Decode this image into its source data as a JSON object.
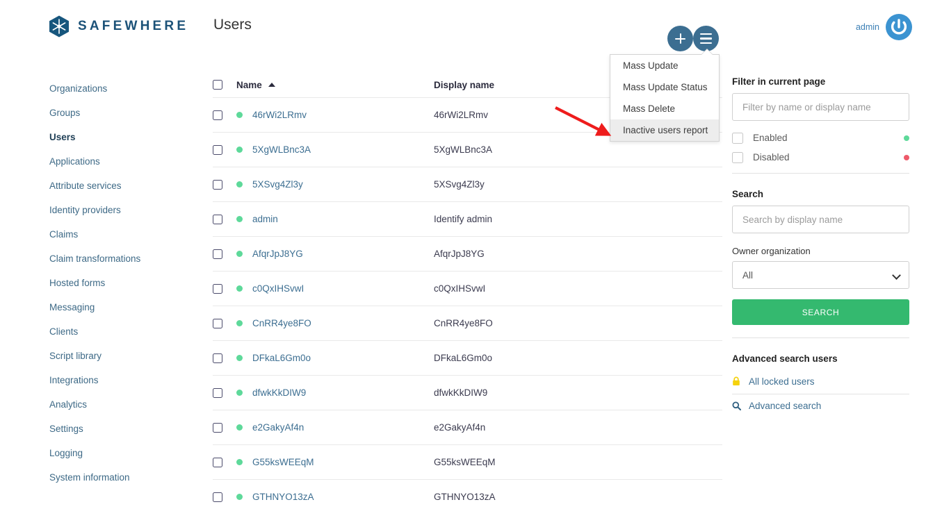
{
  "brand": {
    "name": "SAFEWHERE",
    "logo_icon": "snowflake-hexagon-logo"
  },
  "header": {
    "page_title": "Users",
    "add_button_label": "+",
    "add_icon": "plus-icon",
    "menu_icon": "hamburger-menu-icon",
    "account_name": "admin",
    "avatar_icon": "power-avatar-icon"
  },
  "sidebar": {
    "items": [
      {
        "label": "Organizations",
        "active": false
      },
      {
        "label": "Groups",
        "active": false
      },
      {
        "label": "Users",
        "active": true
      },
      {
        "label": "Applications",
        "active": false
      },
      {
        "label": "Attribute services",
        "active": false
      },
      {
        "label": "Identity providers",
        "active": false
      },
      {
        "label": "Claims",
        "active": false
      },
      {
        "label": "Claim transformations",
        "active": false
      },
      {
        "label": "Hosted forms",
        "active": false
      },
      {
        "label": "Messaging",
        "active": false
      },
      {
        "label": "Clients",
        "active": false
      },
      {
        "label": "Script library",
        "active": false
      },
      {
        "label": "Integrations",
        "active": false
      },
      {
        "label": "Analytics",
        "active": false
      },
      {
        "label": "Settings",
        "active": false
      },
      {
        "label": "Logging",
        "active": false
      },
      {
        "label": "System information",
        "active": false
      }
    ]
  },
  "table": {
    "columns": [
      {
        "label": "Name",
        "sort": "asc",
        "sort_icon": "sort-ascending-caret"
      },
      {
        "label": "Display name",
        "sort": "none"
      }
    ],
    "rows": [
      {
        "status": "enabled",
        "name": "46rWi2LRmv",
        "display_name": "46rWi2LRmv"
      },
      {
        "status": "enabled",
        "name": "5XgWLBnc3A",
        "display_name": "5XgWLBnc3A"
      },
      {
        "status": "enabled",
        "name": "5XSvg4Zl3y",
        "display_name": "5XSvg4Zl3y"
      },
      {
        "status": "enabled",
        "name": "admin",
        "display_name": "Identify admin"
      },
      {
        "status": "enabled",
        "name": "AfqrJpJ8YG",
        "display_name": "AfqrJpJ8YG"
      },
      {
        "status": "enabled",
        "name": "c0QxIHSvwI",
        "display_name": "c0QxIHSvwI"
      },
      {
        "status": "enabled",
        "name": "CnRR4ye8FO",
        "display_name": "CnRR4ye8FO"
      },
      {
        "status": "enabled",
        "name": "DFkaL6Gm0o",
        "display_name": "DFkaL6Gm0o"
      },
      {
        "status": "enabled",
        "name": "dfwkKkDIW9",
        "display_name": "dfwkKkDIW9"
      },
      {
        "status": "enabled",
        "name": "e2GakyAf4n",
        "display_name": "e2GakyAf4n"
      },
      {
        "status": "enabled",
        "name": "G55ksWEEqM",
        "display_name": "G55ksWEEqM"
      },
      {
        "status": "enabled",
        "name": "GTHNYO13zA",
        "display_name": "GTHNYO13zA"
      }
    ]
  },
  "actions_menu": {
    "open": true,
    "items": [
      {
        "label": "Mass Update",
        "highlighted": false
      },
      {
        "label": "Mass Update Status",
        "highlighted": false
      },
      {
        "label": "Mass Delete",
        "highlighted": false
      },
      {
        "label": "Inactive users report",
        "highlighted": true
      }
    ]
  },
  "annotation": {
    "type": "red-arrow",
    "points_to": "Inactive users report",
    "color": "#ee1c1c"
  },
  "filter_panel": {
    "filter_title": "Filter in current page",
    "filter_input": {
      "value": "",
      "placeholder": "Filter by name or display name"
    },
    "checkboxes": [
      {
        "label": "Enabled",
        "checked": false,
        "dot_color": "#5ed99a"
      },
      {
        "label": "Disabled",
        "checked": false,
        "dot_color": "#ee5a6a"
      }
    ],
    "search_title": "Search",
    "search_input": {
      "value": "",
      "placeholder": "Search by display name"
    },
    "owner_org_label": "Owner organization",
    "owner_org_selected": "All",
    "owner_org_options": [
      "All"
    ],
    "search_button_label": "SEARCH",
    "advanced_title": "Advanced search users",
    "advanced_links": [
      {
        "label": "All locked users",
        "icon": "lock-icon"
      },
      {
        "label": "Advanced search",
        "icon": "search-icon"
      }
    ]
  },
  "colors": {
    "brand_blue": "#1c5278",
    "button_blue": "#3c6e91",
    "link_blue": "#3c6e91",
    "green_status": "#5ed99a",
    "red_status": "#ee5a6a",
    "search_green": "#34b96f",
    "lock_yellow": "#f5d20c",
    "annotation_red": "#ee1c1c"
  }
}
